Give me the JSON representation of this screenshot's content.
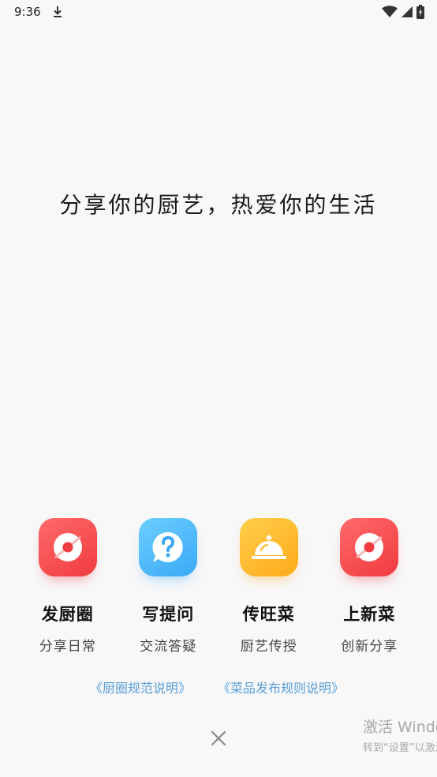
{
  "status_bar": {
    "time": "9:36",
    "icons": [
      "download-icon",
      "wifi-icon",
      "signal-icon",
      "battery-icon"
    ]
  },
  "slogan": "分享你的厨艺，热爱你的生活",
  "actions": [
    {
      "title": "发厨圈",
      "subtitle": "分享日常",
      "icon": "red-record-icon",
      "color": "#f03b3f"
    },
    {
      "title": "写提问",
      "subtitle": "交流答疑",
      "icon": "question-bubble-icon",
      "color": "#3aa8f5"
    },
    {
      "title": "传旺菜",
      "subtitle": "厨艺传授",
      "icon": "cloche-icon",
      "color": "#ffaa1a"
    },
    {
      "title": "上新菜",
      "subtitle": "创新分享",
      "icon": "red-record-icon",
      "color": "#f03b3f"
    }
  ],
  "rules": {
    "circle_rules": "《厨圈规范说明》",
    "dish_rules": "《菜品发布规则说明》"
  },
  "watermark": {
    "title": "激活 Windows",
    "subtitle": "转到“设置”以激活 Windows。"
  }
}
